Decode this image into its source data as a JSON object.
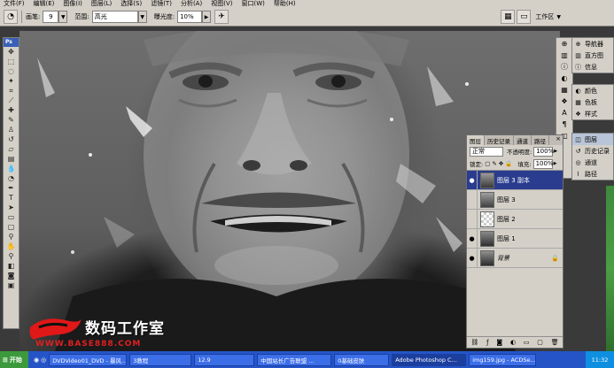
{
  "menubar": {
    "items": [
      "文件(F)",
      "编辑(E)",
      "图像(I)",
      "图层(L)",
      "选择(S)",
      "滤镜(T)",
      "分析(A)",
      "视图(V)",
      "窗口(W)",
      "帮助(H)"
    ]
  },
  "options": {
    "brush_label": "画笔:",
    "brush_size": "9",
    "range_label": "范围:",
    "range_value": "高光",
    "exposure_label": "曝光度:",
    "exposure_value": "10%",
    "workspace_label": "工作区"
  },
  "tools": {
    "header": "Ps"
  },
  "dock_panels": {
    "group1": [
      "导航器",
      "直方图",
      "信息"
    ],
    "group2": [
      "颜色",
      "色板",
      "样式"
    ],
    "group3": [
      "图层",
      "历史记录",
      "通道",
      "路径"
    ]
  },
  "layers_panel": {
    "tabs": [
      "图层",
      "历史记录",
      "通道",
      "路径"
    ],
    "blend_mode": "正常",
    "opacity_label": "不透明度:",
    "opacity_value": "100%",
    "lock_label": "锁定:",
    "fill_label": "填充:",
    "fill_value": "100%",
    "layers": [
      {
        "name": "图层 3 副本",
        "visible": true,
        "selected": true
      },
      {
        "name": "图层 3",
        "visible": false,
        "selected": false
      },
      {
        "name": "图层 2",
        "visible": false,
        "selected": false
      },
      {
        "name": "图层 1",
        "visible": true,
        "selected": false
      },
      {
        "name": "背景",
        "visible": true,
        "selected": false
      }
    ]
  },
  "watermark": {
    "title": "数码工作室",
    "url": "WWW.BASE888.COM"
  },
  "taskbar": {
    "start": "开始",
    "tasks": [
      "DVDVideo01_DVD - 暴风...",
      "3教程",
      "12.9",
      "中国站长广告联盟 ...",
      "0基础皮肤",
      "Adobe Photoshop C...",
      "img159.jpg - ACDSe..."
    ],
    "clock": "11:32"
  },
  "colors": {
    "taskbar": "#2554c7",
    "selected_layer": "#2a3c8e",
    "start": "#3c9a3c"
  }
}
